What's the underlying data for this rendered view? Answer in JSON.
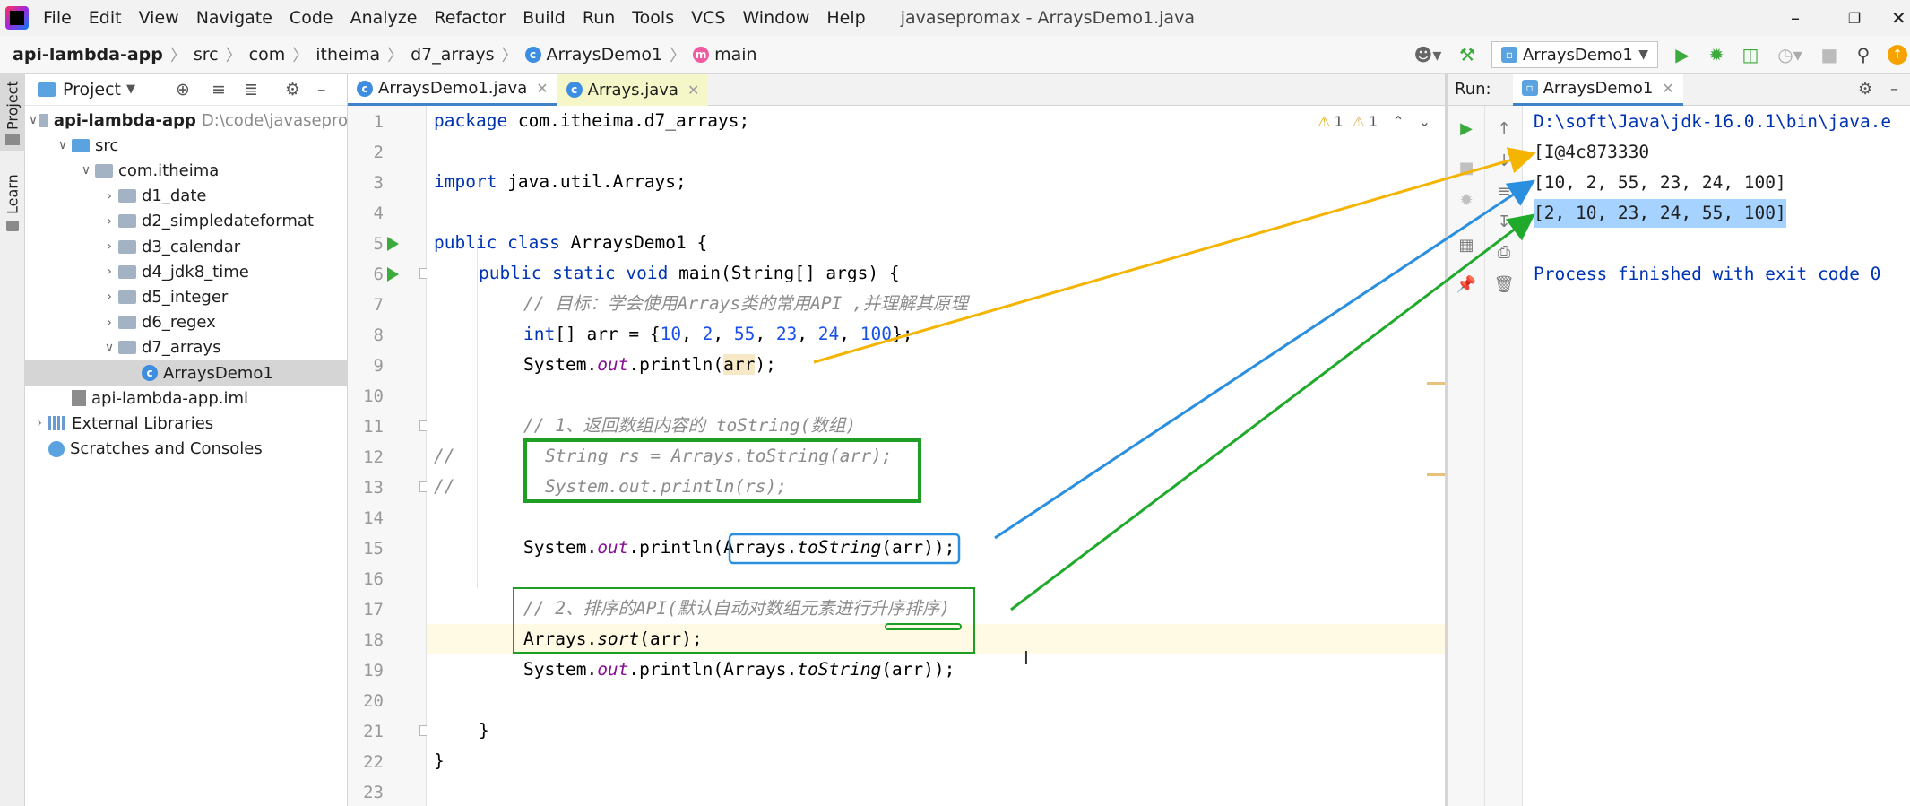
{
  "menubar": {
    "items": [
      "File",
      "Edit",
      "View",
      "Navigate",
      "Code",
      "Analyze",
      "Refactor",
      "Build",
      "Run",
      "Tools",
      "VCS",
      "Window",
      "Help"
    ],
    "window_title": "javasepromax - ArraysDemo1.java"
  },
  "navbar": {
    "crumbs": [
      "api-lambda-app",
      "src",
      "com",
      "itheima",
      "d7_arrays",
      "ArraysDemo1",
      "main"
    ],
    "run_config": "ArraysDemo1"
  },
  "left_strip": {
    "tabs": [
      "Project",
      "Learn"
    ]
  },
  "project": {
    "title": "Project",
    "tree": [
      {
        "label": "api-lambda-app",
        "hint": "D:\\code\\javasepro",
        "level": 0,
        "arrow": "down",
        "icon": "folder",
        "bold": true
      },
      {
        "label": "src",
        "level": 1,
        "arrow": "down",
        "icon": "src"
      },
      {
        "label": "com.itheima",
        "level": 2,
        "arrow": "down",
        "icon": "pkg"
      },
      {
        "label": "d1_date",
        "level": 3,
        "arrow": "right",
        "icon": "pkg"
      },
      {
        "label": "d2_simpledateformat",
        "level": 3,
        "arrow": "right",
        "icon": "pkg"
      },
      {
        "label": "d3_calendar",
        "level": 3,
        "arrow": "right",
        "icon": "pkg"
      },
      {
        "label": "d4_jdk8_time",
        "level": 3,
        "arrow": "right",
        "icon": "pkg"
      },
      {
        "label": "d5_integer",
        "level": 3,
        "arrow": "right",
        "icon": "pkg"
      },
      {
        "label": "d6_regex",
        "level": 3,
        "arrow": "right",
        "icon": "pkg"
      },
      {
        "label": "d7_arrays",
        "level": 3,
        "arrow": "down",
        "icon": "pkg"
      },
      {
        "label": "ArraysDemo1",
        "level": 4,
        "arrow": "",
        "icon": "class",
        "selected": true
      },
      {
        "label": "api-lambda-app.iml",
        "level": 1,
        "arrow": "",
        "icon": "iml"
      },
      {
        "label": "External Libraries",
        "level": 0,
        "arrow": "right",
        "icon": "lib"
      },
      {
        "label": "Scratches and Consoles",
        "level": 0,
        "arrow": "",
        "icon": "scratch"
      }
    ]
  },
  "editor": {
    "tabs": [
      {
        "label": "ArraysDemo1.java",
        "active": true
      },
      {
        "label": "Arrays.java",
        "active": false
      }
    ],
    "inspections": {
      "warn1": "1",
      "warn2": "1"
    },
    "line_numbers": [
      "1",
      "2",
      "3",
      "4",
      "5",
      "6",
      "7",
      "8",
      "9",
      "10",
      "11",
      "12",
      "13",
      "14",
      "15",
      "16",
      "17",
      "18",
      "19",
      "20",
      "21",
      "22",
      "23"
    ],
    "code": {
      "l1_kw": "package",
      "l1_rest": " com.itheima.d7_arrays;",
      "l3_kw": "import",
      "l3_rest": " java.util.Arrays;",
      "l5_kw": "public class",
      "l5_rest": " ArraysDemo1 {",
      "l6_kw": "public static void",
      "l6_rest": " main(String[] args) {",
      "l7": "// 目标：学会使用Arrays类的常用API ,并理解其原理",
      "l8_kw": "int",
      "l8_a": "[] arr = {",
      "n1": "10",
      "n2": "2",
      "n3": "55",
      "n4": "23",
      "n5": "24",
      "n6": "100",
      "l8_end": "};",
      "l9_a": "System.",
      "out": "out",
      "l9_b": ".println(",
      "l9_arr": "arr",
      "l9_c": ");",
      "l11": "// 1、返回数组内容的 toString(数组)",
      "l12_c": "//",
      "l12": "String rs = Arrays.toString(arr);",
      "l13_c": "//",
      "l13": "System.out.println(rs);",
      "l15_a": ".println(",
      "l15_b": "Arrays.",
      "toString": "toString",
      "l15_c": "(arr)",
      "l15_d": ");",
      "l17": "// 2、排序的API(默认自动对数组元素进行升序排序)",
      "l18_a": "Arrays.",
      "sort": "sort",
      "l18_b": "(arr);",
      "l19_a": ".println(Arrays.",
      "l19_b": "(arr));",
      "brace": "}"
    }
  },
  "run": {
    "label": "Run:",
    "tab": "ArraysDemo1",
    "console": [
      "D:\\soft\\Java\\jdk-16.0.1\\bin\\java.e",
      "[I@4c873330",
      "[10, 2, 55, 23, 24, 100]",
      "[2, 10, 23, 24, 55, 100]",
      "",
      "Process finished with exit code 0"
    ]
  },
  "colors": {
    "arrow_orange": "#f5b400",
    "arrow_blue": "#2b8fe0",
    "arrow_green": "#1faa2b",
    "box_green": "#1e9e25",
    "box_blue": "#2b8fe0"
  }
}
